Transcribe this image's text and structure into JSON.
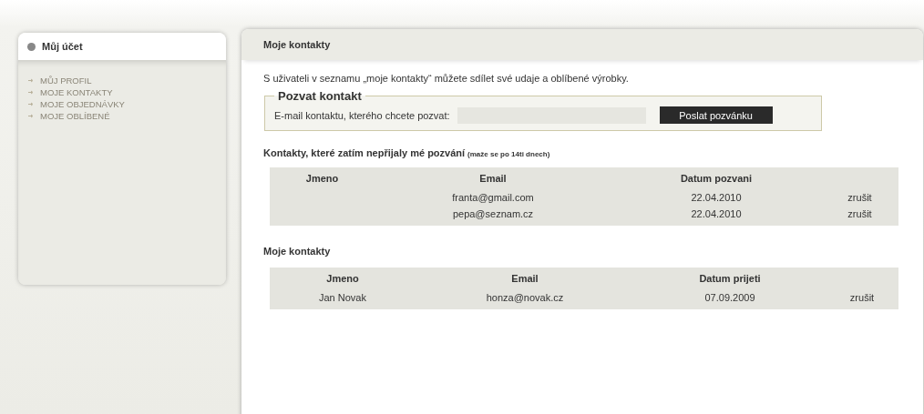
{
  "sidebar": {
    "title": "Můj účet",
    "items": [
      {
        "label": "MŮJ PROFIL"
      },
      {
        "label": "MOJE KONTAKTY"
      },
      {
        "label": "MOJE OBJEDNÁVKY"
      },
      {
        "label": "MOJE OBLÍBENÉ"
      }
    ]
  },
  "main": {
    "title": "Moje kontakty",
    "intro": "S uživateli v seznamu „moje kontakty“ můžete sdílet své udaje a oblíbené výrobky.",
    "invite": {
      "legend": "Pozvat kontakt",
      "label": "E-mail kontaktu, kterého chcete pozvat:",
      "button": "Poslat pozvánku"
    },
    "pending": {
      "heading": "Kontakty, které zatím nepřijaly mé pozvání",
      "note": "(maže se po 14ti dnech)",
      "columns": [
        "Jmeno",
        "Email",
        "Datum pozvani",
        ""
      ],
      "rows": [
        [
          "",
          "franta@gmail.com",
          "22.04.2010",
          "zrušit"
        ],
        [
          "",
          "pepa@seznam.cz",
          "22.04.2010",
          "zrušit"
        ]
      ]
    },
    "contacts": {
      "heading": "Moje kontakty",
      "columns": [
        "Jmeno",
        "Email",
        "Datum prijeti",
        ""
      ],
      "rows": [
        [
          "Jan Novak",
          "honza@novak.cz",
          "07.09.2009",
          "zrušit"
        ]
      ]
    }
  }
}
